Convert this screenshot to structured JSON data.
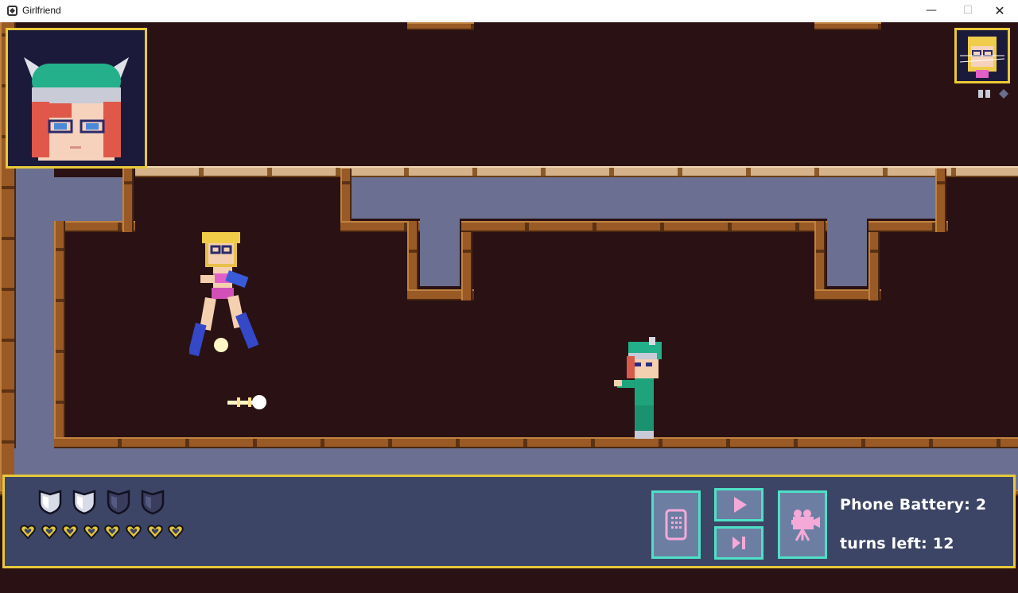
{
  "window": {
    "title": "Girlfriend",
    "minimize": "—",
    "maximize": "☐",
    "close": "✕"
  },
  "hud": {
    "shields": {
      "total": 4,
      "filled": 2
    },
    "hearts": {
      "total": 8,
      "filled": 8
    },
    "phone_battery_text": "Phone Battery: 2",
    "turns_left_text": "turns left: 12"
  },
  "icons": {
    "app": "app-icon",
    "phone": "phone-icon",
    "play": "play-icon",
    "step": "step-forward-icon",
    "camera": "camera-icon",
    "shield": "shield-icon",
    "heart": "heart-icon"
  },
  "colors": {
    "hud_border": "#e8c93a",
    "button_border": "#4ee0c6",
    "button_fill": "#6d7ea3",
    "icon_pink": "#f5a9d8",
    "background": "#2a1113",
    "wall": "#6b6f91"
  }
}
